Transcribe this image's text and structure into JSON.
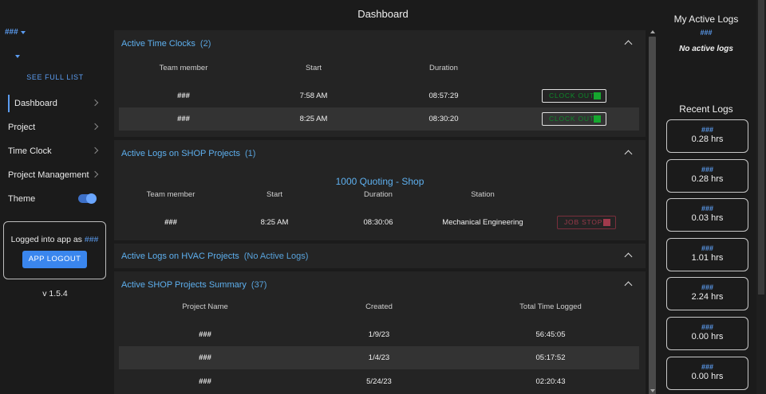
{
  "sidebar": {
    "account": "###",
    "see_full_list": "SEE FULL LIST",
    "items": [
      {
        "label": "Dashboard"
      },
      {
        "label": "Project"
      },
      {
        "label": "Time Clock"
      },
      {
        "label": "Project Management"
      },
      {
        "label": "Theme"
      }
    ],
    "login_text": "Logged into app as",
    "login_user": "###",
    "logout_label": "APP LOGOUT",
    "version": "v 1.5.4"
  },
  "header": {
    "title": "Dashboard"
  },
  "time_clocks": {
    "title": "Active Time Clocks",
    "count": "(2)",
    "headers": [
      "Team member",
      "Start",
      "Duration"
    ],
    "rows": [
      {
        "member": "###",
        "start": "7:58 AM",
        "duration": "08:57:29",
        "action": "CLOCK OUT"
      },
      {
        "member": "###",
        "start": "8:25 AM",
        "duration": "08:30:20",
        "action": "CLOCK OUT"
      }
    ]
  },
  "shop_logs": {
    "title": "Active Logs on SHOP Projects",
    "count": "(1)",
    "project": "1000 Quoting - Shop",
    "headers": [
      "Team member",
      "Start",
      "Duration",
      "Station"
    ],
    "rows": [
      {
        "member": "###",
        "start": "8:25 AM",
        "duration": "08:30:06",
        "station": "Mechanical Engineering",
        "action": "JOB STOP"
      }
    ]
  },
  "hvac_logs": {
    "title": "Active Logs on HVAC Projects",
    "count": "(No Active Logs)"
  },
  "shop_summary": {
    "title": "Active SHOP Projects Summary",
    "count": "(37)",
    "headers": [
      "Project Name",
      "Created",
      "Total Time Logged"
    ],
    "rows": [
      {
        "name": "###",
        "created": "1/9/23",
        "total": "56:45:05"
      },
      {
        "name": "###",
        "created": "1/4/23",
        "total": "05:17:52"
      },
      {
        "name": "###",
        "created": "5/24/23",
        "total": "02:20:43"
      }
    ]
  },
  "my_logs": {
    "title": "My Active Logs",
    "account": "###",
    "empty": "No active logs"
  },
  "recent_logs": {
    "title": "Recent Logs",
    "items": [
      {
        "user": "###",
        "hours": "0.28 hrs"
      },
      {
        "user": "###",
        "hours": "0.28 hrs"
      },
      {
        "user": "###",
        "hours": "0.03 hrs"
      },
      {
        "user": "###",
        "hours": "1.01 hrs"
      },
      {
        "user": "###",
        "hours": "2.24 hrs"
      },
      {
        "user": "###",
        "hours": "0.00 hrs"
      },
      {
        "user": "###",
        "hours": "0.00 hrs"
      }
    ]
  },
  "colors": {
    "accent": "#5b9cf0",
    "clock_out": "#16a82f",
    "job_stop": "#a03a4c"
  }
}
